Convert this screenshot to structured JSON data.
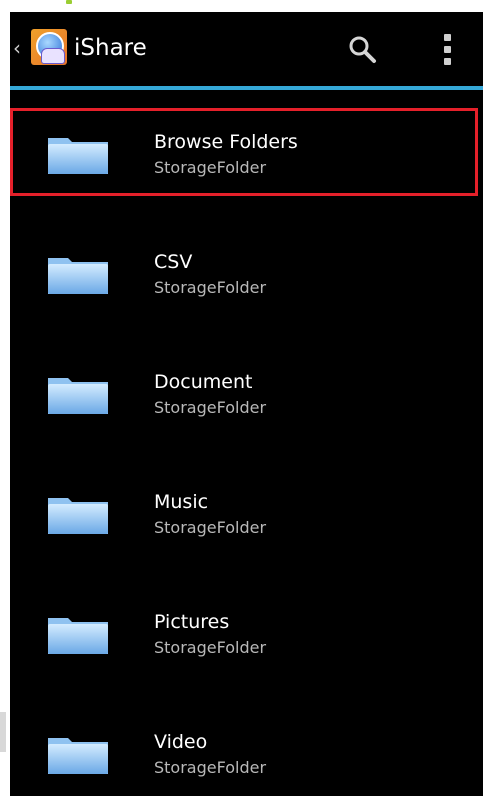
{
  "app": {
    "title": "iShare",
    "back_icon": "chevron-left-icon",
    "app_icon": "ishare-logo-icon"
  },
  "actions": {
    "search_icon": "search-icon",
    "overflow_icon": "overflow-menu-icon"
  },
  "colors": {
    "accent": "#35a8d8",
    "selection": "#e5202a",
    "background": "#000000"
  },
  "items": [
    {
      "name": "Browse Folders",
      "type": "StorageFolder",
      "selected": true
    },
    {
      "name": "CSV",
      "type": "StorageFolder"
    },
    {
      "name": "Document",
      "type": "StorageFolder"
    },
    {
      "name": "Music",
      "type": "StorageFolder"
    },
    {
      "name": "Pictures",
      "type": "StorageFolder"
    },
    {
      "name": "Video",
      "type": "StorageFolder"
    }
  ]
}
